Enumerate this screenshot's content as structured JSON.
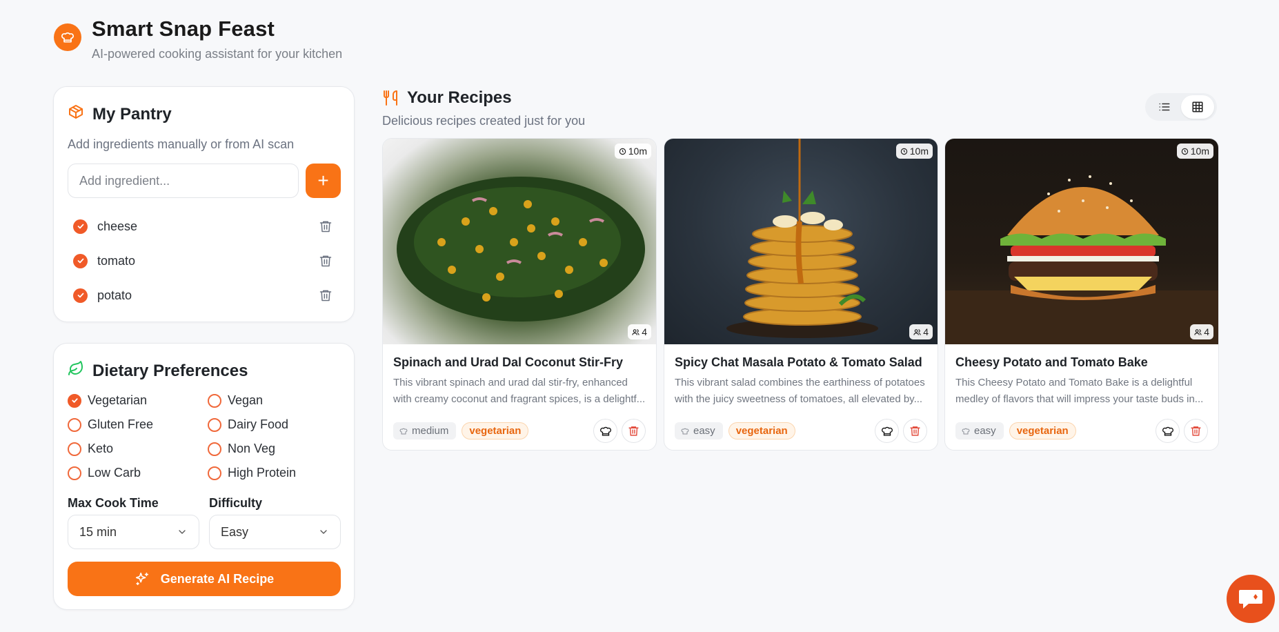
{
  "app": {
    "title": "Smart Snap Feast",
    "subtitle": "AI-powered cooking assistant for your kitchen",
    "logo_icon": "chef-hat-icon",
    "accent": "#f97316"
  },
  "pantry": {
    "title": "My Pantry",
    "description": "Add ingredients manually or from AI scan",
    "input_placeholder": "Add ingredient...",
    "add_label": "+",
    "items": [
      {
        "name": "cheese",
        "checked": true
      },
      {
        "name": "tomato",
        "checked": true
      },
      {
        "name": "potato",
        "checked": true
      }
    ]
  },
  "preferences": {
    "title": "Dietary Preferences",
    "options": [
      {
        "label": "Vegetarian",
        "checked": true
      },
      {
        "label": "Vegan",
        "checked": false
      },
      {
        "label": "Gluten Free",
        "checked": false
      },
      {
        "label": "Dairy Food",
        "checked": false
      },
      {
        "label": "Keto",
        "checked": false
      },
      {
        "label": "Non Veg",
        "checked": false
      },
      {
        "label": "Low Carb",
        "checked": false
      },
      {
        "label": "High Protein",
        "checked": false
      }
    ],
    "max_cook_time": {
      "label": "Max Cook Time",
      "value": "15 min"
    },
    "difficulty": {
      "label": "Difficulty",
      "value": "Easy"
    },
    "generate_label": "Generate AI Recipe"
  },
  "recipes": {
    "title": "Your Recipes",
    "subtitle": "Delicious recipes created just for you",
    "view_mode": "grid",
    "items": [
      {
        "title": "Spinach and Urad Dal Coconut Stir-Fry",
        "description": "This vibrant spinach and urad dal stir-fry, enhanced with creamy coconut and fragrant spices, is a delightf...",
        "time": "10m",
        "servings": "4",
        "difficulty": "medium",
        "diet": "vegetarian"
      },
      {
        "title": "Spicy Chat Masala Potato & Tomato Salad",
        "description": "This vibrant salad combines the earthiness of potatoes with the juicy sweetness of tomatoes, all elevated by...",
        "time": "10m",
        "servings": "4",
        "difficulty": "easy",
        "diet": "vegetarian"
      },
      {
        "title": "Cheesy Potato and Tomato Bake",
        "description": "This Cheesy Potato and Tomato Bake is a delightful medley of flavors that will impress your taste buds in...",
        "time": "10m",
        "servings": "4",
        "difficulty": "easy",
        "diet": "vegetarian"
      }
    ]
  }
}
